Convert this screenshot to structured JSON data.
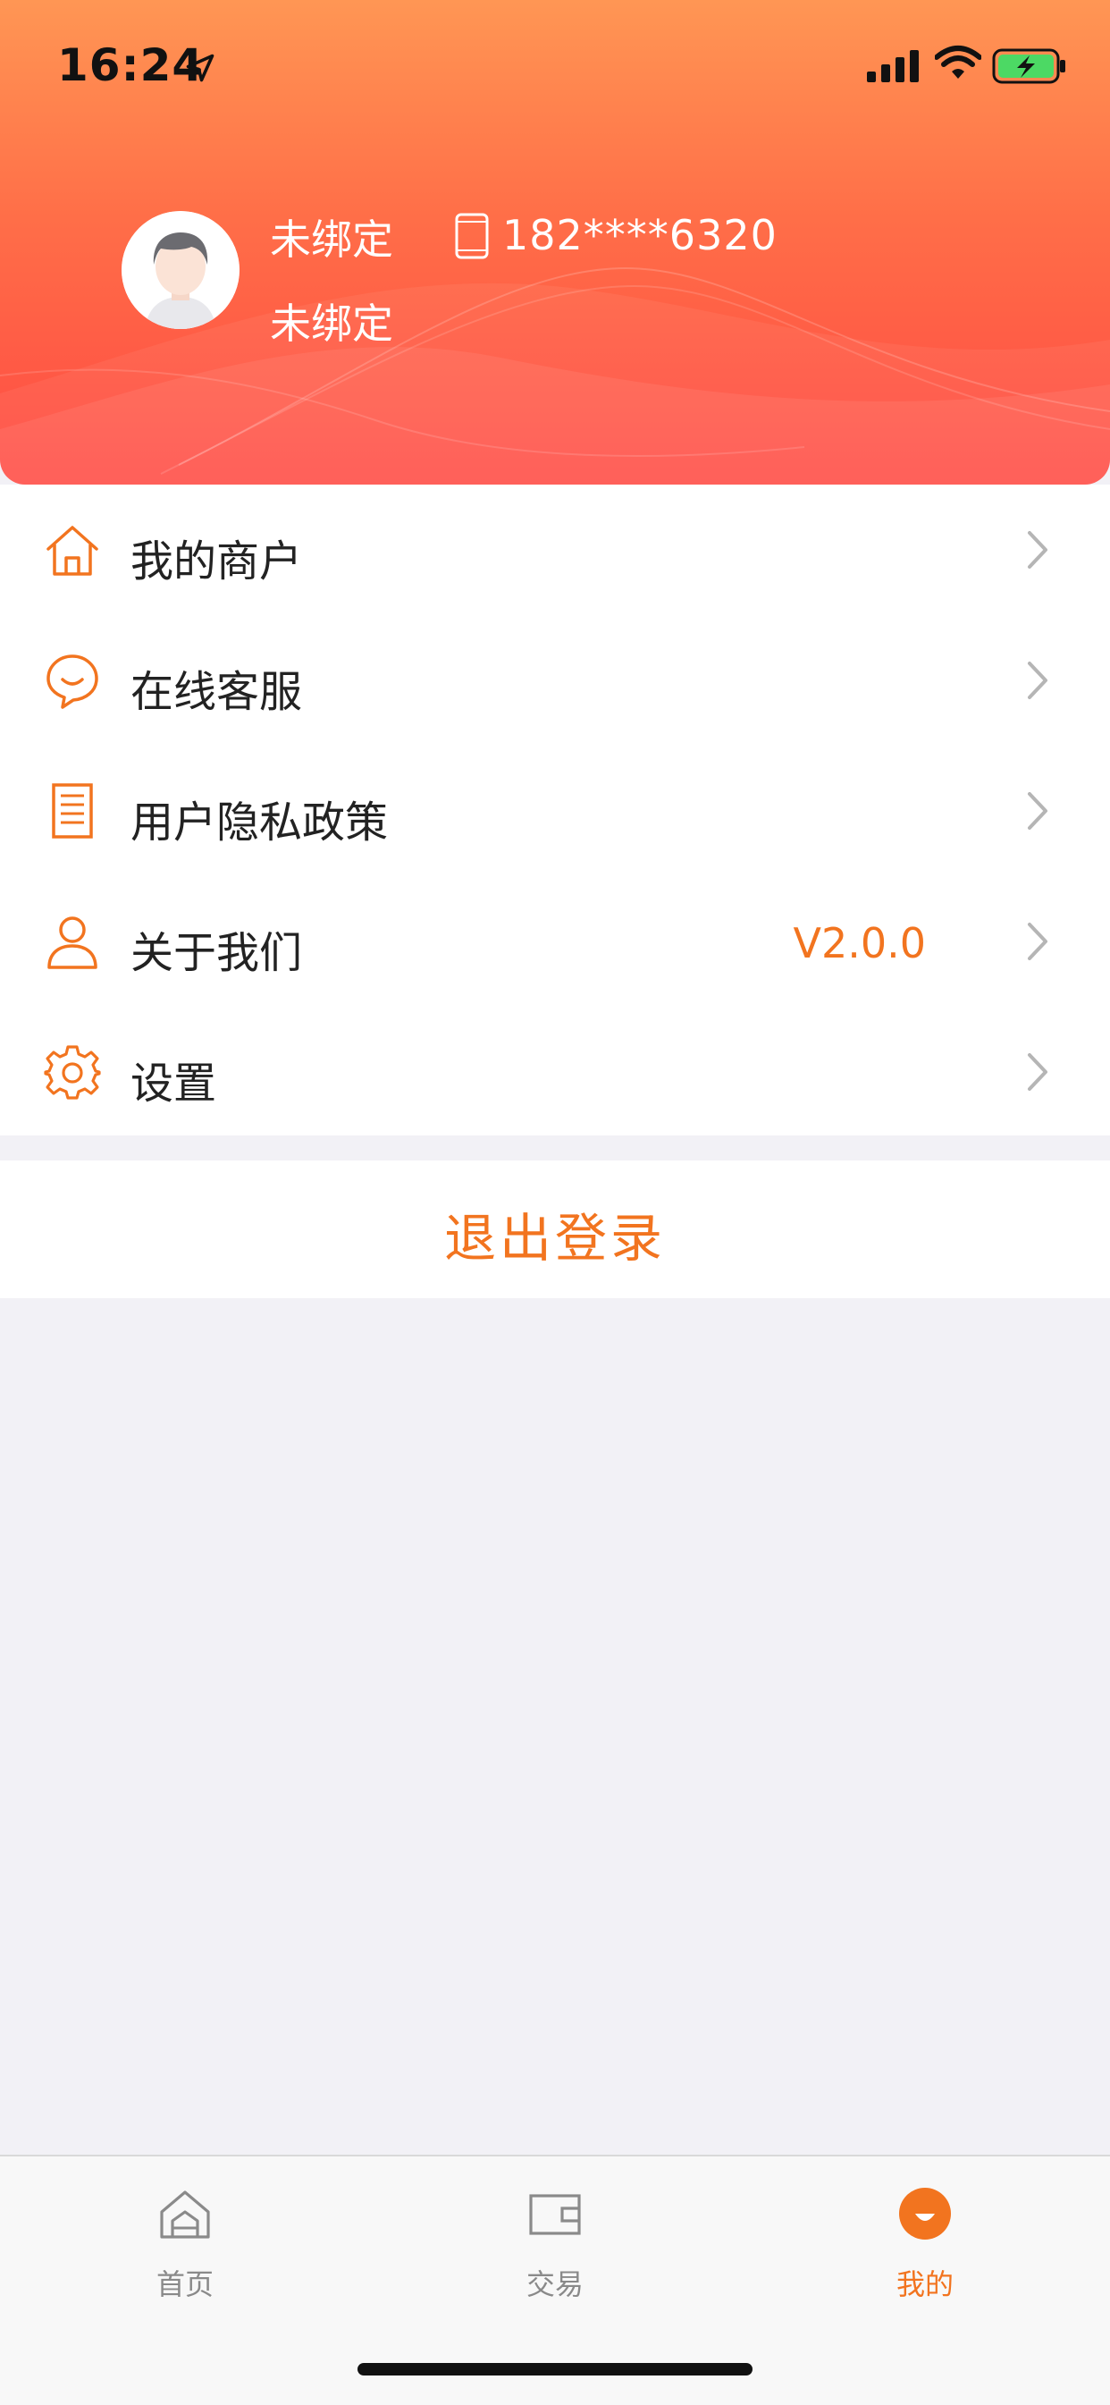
{
  "status_bar": {
    "time": "16:24"
  },
  "profile": {
    "name": "未绑定",
    "subtitle": "未绑定",
    "phone": "182****6320"
  },
  "menu": {
    "items": [
      {
        "label": "我的商户",
        "icon": "house-icon"
      },
      {
        "label": "在线客服",
        "icon": "chat-smile-icon"
      },
      {
        "label": "用户隐私政策",
        "icon": "document-icon"
      },
      {
        "label": "关于我们",
        "icon": "person-icon",
        "value": "V2.0.0"
      },
      {
        "label": "设置",
        "icon": "gear-icon"
      }
    ]
  },
  "logout_label": "退出登录",
  "tabbar": {
    "tabs": [
      {
        "label": "首页",
        "icon": "home-icon"
      },
      {
        "label": "交易",
        "icon": "wallet-icon"
      },
      {
        "label": "我的",
        "icon": "profile-face-icon",
        "active": true
      }
    ]
  },
  "colors": {
    "accent": "#f2741f",
    "header_top": "#ff9654",
    "header_bottom": "#ff4a43",
    "background": "#f2f1f6"
  }
}
